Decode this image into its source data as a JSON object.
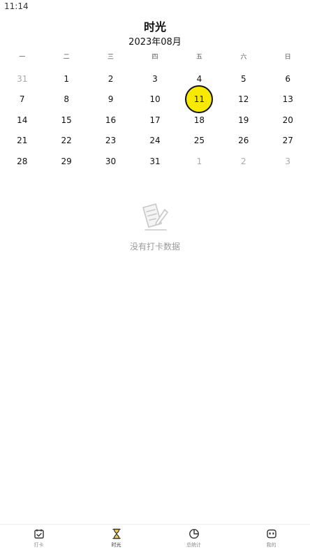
{
  "status_bar": {
    "time": "11:14"
  },
  "header": {
    "title": "时光",
    "month": "2023年08月"
  },
  "calendar": {
    "weekdays": [
      "一",
      "二",
      "三",
      "四",
      "五",
      "六",
      "日"
    ],
    "weeks": [
      [
        {
          "d": "31",
          "other": true
        },
        {
          "d": "1"
        },
        {
          "d": "2"
        },
        {
          "d": "3"
        },
        {
          "d": "4"
        },
        {
          "d": "5"
        },
        {
          "d": "6"
        }
      ],
      [
        {
          "d": "7"
        },
        {
          "d": "8"
        },
        {
          "d": "9"
        },
        {
          "d": "10"
        },
        {
          "d": "11",
          "selected": true
        },
        {
          "d": "12"
        },
        {
          "d": "13"
        }
      ],
      [
        {
          "d": "14"
        },
        {
          "d": "15"
        },
        {
          "d": "16"
        },
        {
          "d": "17"
        },
        {
          "d": "18"
        },
        {
          "d": "19"
        },
        {
          "d": "20"
        }
      ],
      [
        {
          "d": "21"
        },
        {
          "d": "22"
        },
        {
          "d": "23"
        },
        {
          "d": "24"
        },
        {
          "d": "25"
        },
        {
          "d": "26"
        },
        {
          "d": "27"
        }
      ],
      [
        {
          "d": "28"
        },
        {
          "d": "29"
        },
        {
          "d": "30"
        },
        {
          "d": "31"
        },
        {
          "d": "1",
          "other": true
        },
        {
          "d": "2",
          "other": true
        },
        {
          "d": "3",
          "other": true
        }
      ]
    ],
    "selected_color": "#f7ea00"
  },
  "empty_state": {
    "icon": "note-pencil-icon",
    "text": "没有打卡数据"
  },
  "tabs": [
    {
      "label": "打卡",
      "icon": "checkin-calendar-icon",
      "active": false
    },
    {
      "label": "时光",
      "icon": "hourglass-icon",
      "active": true
    },
    {
      "label": "总统计",
      "icon": "pie-chart-icon",
      "active": false
    },
    {
      "label": "我的",
      "icon": "robot-face-icon",
      "active": false
    }
  ]
}
